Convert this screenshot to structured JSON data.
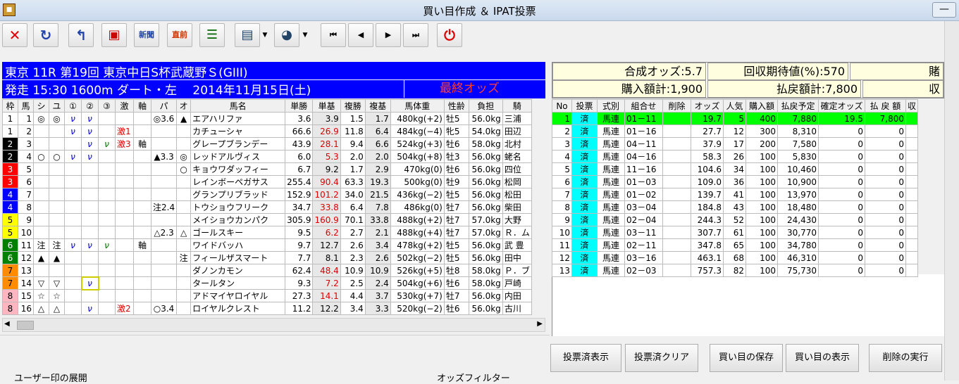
{
  "window": {
    "title": "買い目作成 ＆ IPAT投票",
    "minimize": "—"
  },
  "icons": [
    "close-icon",
    "refresh-icon",
    "back-icon",
    "ticket-icon",
    "shinbun-icon",
    "chokuzen-icon",
    "list-icon",
    "doc-check-icon",
    "pie-check-icon",
    "first-icon",
    "prev-icon",
    "next-icon",
    "last-icon",
    "stop-icon"
  ],
  "toolbar": {
    "shinbun": "新聞",
    "chokuzen": "直前"
  },
  "race": {
    "line1": "東京 11R 第19回 東京中日S杯武蔵野Ｓ(GIII)",
    "line2": "発走 15:30 1600m ダート・左　 2014年11月15日(土)",
    "status": "最終オッズ"
  },
  "summary": {
    "combo_odds": "合成オッズ:5.7",
    "expected": "回収期待値(%):570",
    "col3": "賭",
    "purchase": "購入額計:1,900",
    "payout": "払戻額計:7,800",
    "col6": "収"
  },
  "left_headers": [
    "枠",
    "馬",
    "シ",
    "ユ",
    "①",
    "②",
    "③",
    "激",
    "軸",
    "パ",
    "オ",
    "馬名",
    "単勝",
    "単基",
    "複勝",
    "複基",
    "馬体重",
    "性齢",
    "負担",
    "騎"
  ],
  "horses": [
    [
      "1",
      "1",
      "◎",
      "◎",
      "ν",
      "ν",
      "",
      "",
      "",
      "◎3.6",
      "▲",
      "エアハリファ",
      "3.6",
      "3.9",
      "1.5",
      "1.7",
      "480kg(+2)",
      "牡5",
      "56.0kg",
      "三浦"
    ],
    [
      "1",
      "2",
      "",
      "",
      "ν",
      "ν",
      "",
      "激1",
      "",
      "",
      "",
      "カチューシャ",
      "66.6",
      "26.9",
      "11.8",
      "6.4",
      "484kg(−4)",
      "牝5",
      "54.0kg",
      "田辺"
    ],
    [
      "2",
      "3",
      "",
      "",
      "",
      "ν",
      "ν",
      "激3",
      "軸",
      "",
      "",
      "グレープブランデー",
      "43.9",
      "28.1",
      "9.4",
      "6.6",
      "524kg(+3)",
      "牡6",
      "58.0kg",
      "北村"
    ],
    [
      "2",
      "4",
      "○",
      "○",
      "ν",
      "ν",
      "",
      "",
      "",
      "▲3.3",
      "◎",
      "レッドアルヴィス",
      "6.0",
      "5.3",
      "2.0",
      "2.0",
      "504kg(+8)",
      "牡3",
      "56.0kg",
      "蛯名"
    ],
    [
      "3",
      "5",
      "",
      "",
      "",
      "",
      "",
      "",
      "",
      "",
      "○",
      "キョウワダッフィー",
      "6.7",
      "9.2",
      "1.7",
      "2.9",
      "470kg(0)",
      "牡6",
      "56.0kg",
      "四位"
    ],
    [
      "3",
      "6",
      "",
      "",
      "",
      "",
      "",
      "",
      "",
      "",
      "",
      "レインボーペガサス",
      "255.4",
      "90.4",
      "63.3",
      "19.3",
      "500kg(0)",
      "牡9",
      "56.0kg",
      "松岡"
    ],
    [
      "4",
      "7",
      "",
      "",
      "",
      "",
      "",
      "",
      "",
      "",
      "",
      "グランプリブラッド",
      "152.9",
      "101.2",
      "34.0",
      "21.5",
      "436kg(−2)",
      "牡5",
      "56.0kg",
      "松田"
    ],
    [
      "4",
      "8",
      "",
      "",
      "",
      "",
      "",
      "",
      "",
      "注2.4",
      "",
      "トウショウフリーク",
      "34.7",
      "33.8",
      "6.4",
      "7.8",
      "486kg(0)",
      "牡7",
      "56.0kg",
      "柴田"
    ],
    [
      "5",
      "9",
      "",
      "",
      "",
      "",
      "",
      "",
      "",
      "",
      "",
      "メイショウカンパク",
      "305.9",
      "160.9",
      "70.1",
      "33.8",
      "488kg(+2)",
      "牡7",
      "57.0kg",
      "大野"
    ],
    [
      "5",
      "10",
      "",
      "",
      "",
      "",
      "",
      "",
      "",
      "△2.3",
      "△",
      "ゴールスキー",
      "9.5",
      "6.2",
      "2.7",
      "2.1",
      "488kg(+4)",
      "牡7",
      "57.0kg",
      "Ｒ．ム"
    ],
    [
      "6",
      "11",
      "注",
      "注",
      "ν",
      "ν",
      "ν",
      "",
      "軸",
      "",
      "",
      "ワイドバッハ",
      "9.7",
      "12.7",
      "2.6",
      "3.4",
      "478kg(+2)",
      "牡5",
      "56.0kg",
      "武 豊"
    ],
    [
      "6",
      "12",
      "▲",
      "▲",
      "",
      "",
      "",
      "",
      "",
      "",
      "注",
      "フィールザスマート",
      "7.7",
      "8.1",
      "2.3",
      "2.6",
      "502kg(−2)",
      "牡5",
      "56.0kg",
      "田中"
    ],
    [
      "7",
      "13",
      "",
      "",
      "",
      "",
      "",
      "",
      "",
      "",
      "",
      "ダノンカモン",
      "62.4",
      "48.4",
      "10.9",
      "10.9",
      "526kg(+5)",
      "牡8",
      "58.0kg",
      "Ｐ．ブ"
    ],
    [
      "7",
      "14",
      "▽",
      "▽",
      "",
      "ν",
      "",
      "",
      "",
      "",
      "",
      "タールタン",
      "9.3",
      "7.2",
      "2.5",
      "2.4",
      "504kg(+6)",
      "牡6",
      "58.0kg",
      "戸崎"
    ],
    [
      "8",
      "15",
      "☆",
      "☆",
      "",
      "",
      "",
      "",
      "",
      "",
      "",
      "アドマイヤロイヤル",
      "27.3",
      "14.1",
      "4.4",
      "3.7",
      "530kg(+7)",
      "牡7",
      "56.0kg",
      "内田"
    ],
    [
      "8",
      "16",
      "△",
      "△",
      "",
      "ν",
      "",
      "激2",
      "",
      "○3.4",
      "",
      "ロイヤルクレスト",
      "11.2",
      "12.2",
      "3.4",
      "3.3",
      "520kg(−2)",
      "牡6",
      "56.0kg",
      "古川"
    ]
  ],
  "right_headers": [
    "No",
    "投票",
    "式別",
    "組合せ",
    "削除",
    "オッズ",
    "人気",
    "購入額",
    "払戻予定",
    "確定オッズ",
    "払 戻 額",
    "収"
  ],
  "bets": [
    [
      "1",
      "済",
      "馬連",
      "01－11",
      "",
      "19.7",
      "5",
      "400",
      "7,880",
      "19.5",
      "7,800",
      ""
    ],
    [
      "2",
      "済",
      "馬連",
      "01－16",
      "",
      "27.7",
      "12",
      "300",
      "8,310",
      "0",
      "0",
      ""
    ],
    [
      "3",
      "済",
      "馬連",
      "04－11",
      "",
      "37.9",
      "17",
      "200",
      "7,580",
      "0",
      "0",
      ""
    ],
    [
      "4",
      "済",
      "馬連",
      "04－16",
      "",
      "58.3",
      "26",
      "100",
      "5,830",
      "0",
      "0",
      ""
    ],
    [
      "5",
      "済",
      "馬連",
      "11－16",
      "",
      "104.6",
      "34",
      "100",
      "10,460",
      "0",
      "0",
      ""
    ],
    [
      "6",
      "済",
      "馬連",
      "01－03",
      "",
      "109.0",
      "36",
      "100",
      "10,900",
      "0",
      "0",
      ""
    ],
    [
      "7",
      "済",
      "馬連",
      "01－02",
      "",
      "139.7",
      "41",
      "100",
      "13,970",
      "0",
      "0",
      ""
    ],
    [
      "8",
      "済",
      "馬連",
      "03－04",
      "",
      "184.8",
      "43",
      "100",
      "18,480",
      "0",
      "0",
      ""
    ],
    [
      "9",
      "済",
      "馬連",
      "02－04",
      "",
      "244.3",
      "52",
      "100",
      "24,430",
      "0",
      "0",
      ""
    ],
    [
      "10",
      "済",
      "馬連",
      "03－11",
      "",
      "307.7",
      "61",
      "100",
      "30,770",
      "0",
      "0",
      ""
    ],
    [
      "11",
      "済",
      "馬連",
      "02－11",
      "",
      "347.8",
      "65",
      "100",
      "34,780",
      "0",
      "0",
      ""
    ],
    [
      "12",
      "済",
      "馬連",
      "03－16",
      "",
      "463.1",
      "68",
      "100",
      "46,310",
      "0",
      "0",
      ""
    ],
    [
      "13",
      "済",
      "馬連",
      "02－03",
      "",
      "757.3",
      "82",
      "100",
      "75,730",
      "0",
      "0",
      ""
    ]
  ],
  "buttons": {
    "voted_show": "投票済表示",
    "voted_clear": "投票済クリア",
    "save": "買い目の保存",
    "show": "買い目の表示",
    "delete": "削除の実行"
  },
  "groups": {
    "user_mark": "ユーザー印の展開",
    "odds_filter": "オッズフィルター"
  },
  "colors": {
    "waku": {
      "1": "#ffffff",
      "2": "#000000",
      "3": "#ff0000",
      "4": "#0000ff",
      "5": "#ffff00",
      "6": "#008000",
      "7": "#ff8c00",
      "8": "#ffb6c1"
    }
  }
}
